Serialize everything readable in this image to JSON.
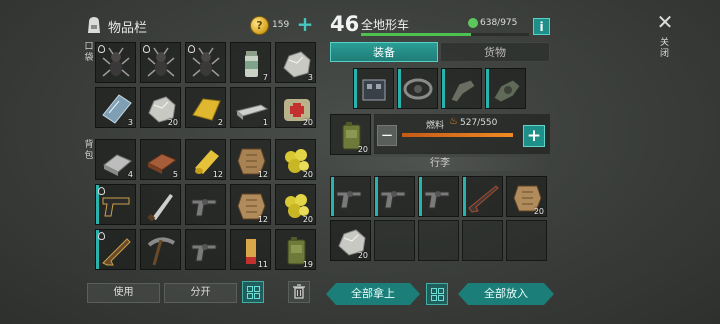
{
  "inventory": {
    "title": "物品栏",
    "coins": "159",
    "coin_symbol": "?",
    "add_label": "+",
    "pockets_label": "口袋",
    "backpack_label": "背包",
    "pockets": [
      {
        "icon": "ant-icon",
        "qty": "",
        "flag": true
      },
      {
        "icon": "ant-icon",
        "qty": "",
        "flag": true
      },
      {
        "icon": "ant-icon",
        "qty": "",
        "flag": true
      },
      {
        "icon": "pill-bottle-icon",
        "qty": "7"
      },
      {
        "icon": "ore-icon",
        "qty": "3"
      },
      {
        "icon": "glass-pane-icon",
        "qty": "3"
      },
      {
        "icon": "ore-icon",
        "qty": "20"
      },
      {
        "icon": "cloth-icon",
        "qty": "2"
      },
      {
        "icon": "steel-bar-icon",
        "qty": "1"
      },
      {
        "icon": "medkit-bag-icon",
        "qty": "20"
      }
    ],
    "backpack": [
      {
        "icon": "metal-ingot-icon",
        "qty": "4"
      },
      {
        "icon": "wood-plank-icon",
        "qty": "5"
      },
      {
        "icon": "cloth-roll-icon",
        "qty": "12"
      },
      {
        "icon": "leather-icon",
        "qty": "12"
      },
      {
        "icon": "gold-nugget-icon",
        "qty": "20"
      },
      {
        "icon": "pistol-icon",
        "qty": "",
        "equipped": true,
        "flag": true
      },
      {
        "icon": "machete-icon",
        "qty": ""
      },
      {
        "icon": "revolver-icon",
        "qty": ""
      },
      {
        "icon": "hide-icon",
        "qty": "12"
      },
      {
        "icon": "gold-nugget-icon",
        "qty": "20"
      },
      {
        "icon": "shotgun-icon",
        "qty": "",
        "equipped": true,
        "flag": true
      },
      {
        "icon": "pickaxe-icon",
        "qty": ""
      },
      {
        "icon": "revolver-icon",
        "qty": ""
      },
      {
        "icon": "shell-icon",
        "qty": "11"
      },
      {
        "icon": "jerrycan-icon",
        "qty": "19"
      }
    ]
  },
  "vehicle": {
    "level": "46",
    "name": "全地形车",
    "durability": "638/975",
    "durability_fraction": 0.654,
    "info_label": "i",
    "tabs": {
      "equipment": "装备",
      "cargo": "货物"
    },
    "equipment": [
      {
        "icon": "engine-block-icon"
      },
      {
        "icon": "chain-icon"
      },
      {
        "icon": "turret-icon"
      },
      {
        "icon": "gearbox-icon"
      }
    ],
    "fuel": {
      "label": "燃料",
      "value": "527/550",
      "fraction": 0.958,
      "can_qty": "20",
      "minus": "−",
      "plus": "+"
    },
    "luggage_label": "行李",
    "luggage": [
      {
        "icon": "revolver-icon",
        "qty": "",
        "equipped": true
      },
      {
        "icon": "revolver-icon",
        "qty": "",
        "equipped": true
      },
      {
        "icon": "revolver-icon",
        "qty": "",
        "equipped": true
      },
      {
        "icon": "rifle-icon",
        "qty": "",
        "equipped": true
      },
      {
        "icon": "hide-icon",
        "qty": "20"
      },
      {
        "icon": "ore-icon",
        "qty": "20"
      },
      {
        "icon": "",
        "qty": ""
      },
      {
        "icon": "",
        "qty": ""
      },
      {
        "icon": "",
        "qty": ""
      },
      {
        "icon": "",
        "qty": ""
      }
    ]
  },
  "buttons": {
    "use": "使用",
    "split": "分开",
    "take_all": "全部拿上",
    "put_all": "全部放入"
  },
  "close": {
    "symbol": "✕",
    "label": "关闭"
  },
  "colors": {
    "accent": "#1f8f8a",
    "durability": "#4ec24e",
    "fuel": "#f08a24"
  }
}
